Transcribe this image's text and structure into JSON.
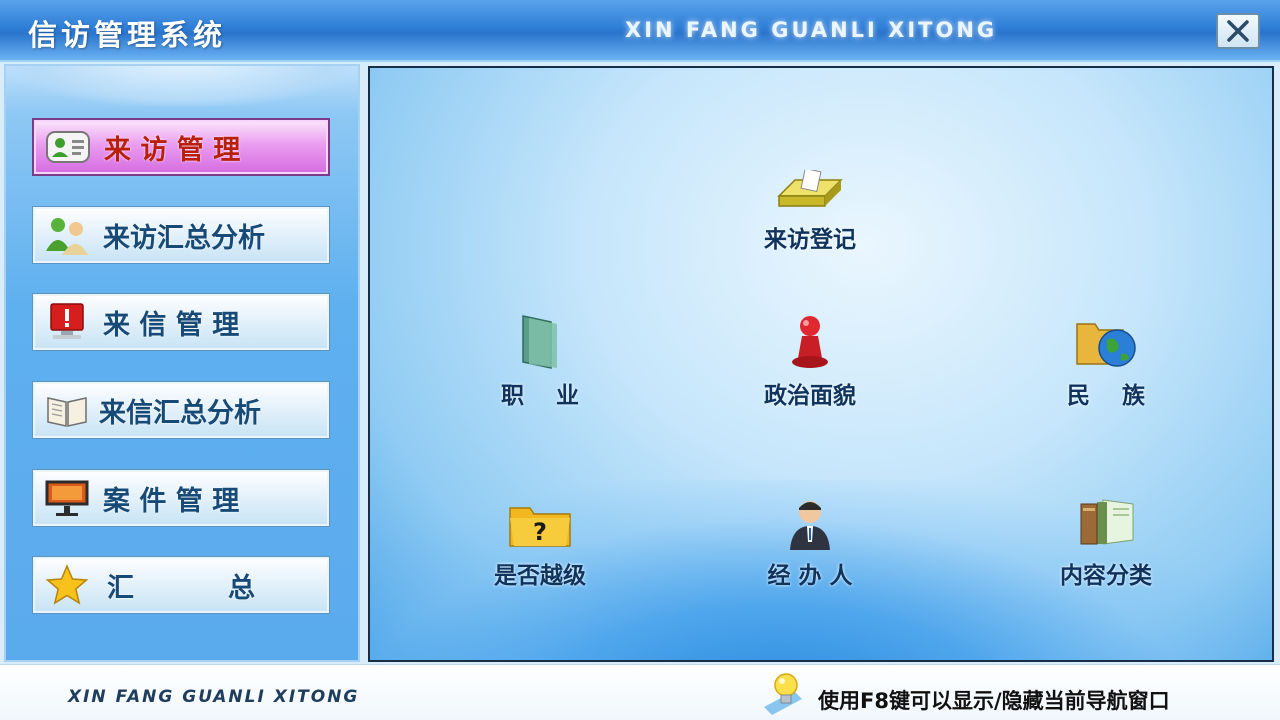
{
  "window": {
    "title": "信访管理系统",
    "subtitle": "XIN FANG GUANLI XITONG",
    "close_label": "✕"
  },
  "sidebar": {
    "items": [
      {
        "label": "来 访 管 理",
        "icon": "contact-card-icon",
        "active": true
      },
      {
        "label": "来访汇总分析",
        "icon": "users-icon",
        "active": false
      },
      {
        "label": "来 信 管 理",
        "icon": "alert-monitor-icon",
        "active": false
      },
      {
        "label": "来信汇总分析",
        "icon": "open-book-icon",
        "active": false
      },
      {
        "label": "案 件 管 理",
        "icon": "presentation-board-icon",
        "active": false
      },
      {
        "label": "汇          总",
        "icon": "star-icon",
        "active": false
      }
    ]
  },
  "main": {
    "tiles": [
      {
        "label": "来访登记",
        "icon": "register-tray-icon"
      },
      {
        "label": "职    业",
        "icon": "green-folder-icon"
      },
      {
        "label": "政治面貌",
        "icon": "red-pawn-icon"
      },
      {
        "label": "民    族",
        "icon": "globe-folder-icon"
      },
      {
        "label": "是否越级",
        "icon": "question-folder-icon"
      },
      {
        "label": "经 办 人",
        "icon": "person-icon"
      },
      {
        "label": "内容分类",
        "icon": "books-icon"
      }
    ]
  },
  "statusbar": {
    "brand": "XIN FANG GUANLI XITONG",
    "hint": "使用F8键可以显示/隐藏当前导航窗口",
    "hint_icon": "lightbulb-icon"
  },
  "colors": {
    "title_bar": "#2f7fd8",
    "active_nav": "#e38ae9",
    "nav_text": "#184a78",
    "active_nav_text": "#b8200c",
    "tile_text": "#10335d"
  }
}
